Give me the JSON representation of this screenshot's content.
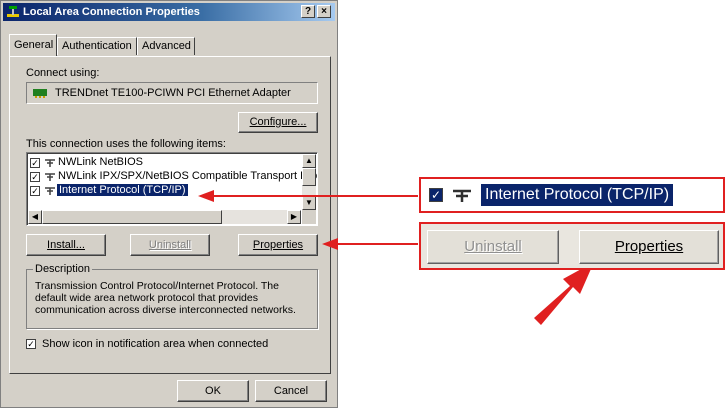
{
  "window": {
    "title": "Local Area Connection Properties",
    "help_btn": "?",
    "close_btn": "×"
  },
  "tabs": [
    {
      "label": "General"
    },
    {
      "label": "Authentication"
    },
    {
      "label": "Advanced"
    }
  ],
  "general": {
    "connect_using_label": "Connect using:",
    "adapter": "TRENDnet TE100-PCIWN PCI Ethernet Adapter",
    "configure_btn": "Configure...",
    "items_label": "This connection uses the following items:",
    "items": [
      {
        "label": "NWLink NetBIOS",
        "checked": true
      },
      {
        "label": "NWLink IPX/SPX/NetBIOS Compatible Transport Proto",
        "checked": true
      },
      {
        "label": "Internet Protocol (TCP/IP)",
        "checked": true,
        "selected": true
      }
    ],
    "install_btn": "Install...",
    "uninstall_btn": "Uninstall",
    "properties_btn": "Properties",
    "description_legend": "Description",
    "description_text": "Transmission Control Protocol/Internet Protocol. The default wide area network protocol that provides communication across diverse interconnected networks.",
    "show_icon_label": "Show icon in notification area when connected",
    "show_icon_checked": true
  },
  "footer": {
    "ok_btn": "OK",
    "cancel_btn": "Cancel"
  },
  "zoom": {
    "item_label": "Internet Protocol (TCP/IP)",
    "uninstall_btn": "Uninstall",
    "properties_btn": "Properties"
  },
  "colors": {
    "callout_red": "#e02020",
    "selection_blue": "#0a246a"
  }
}
